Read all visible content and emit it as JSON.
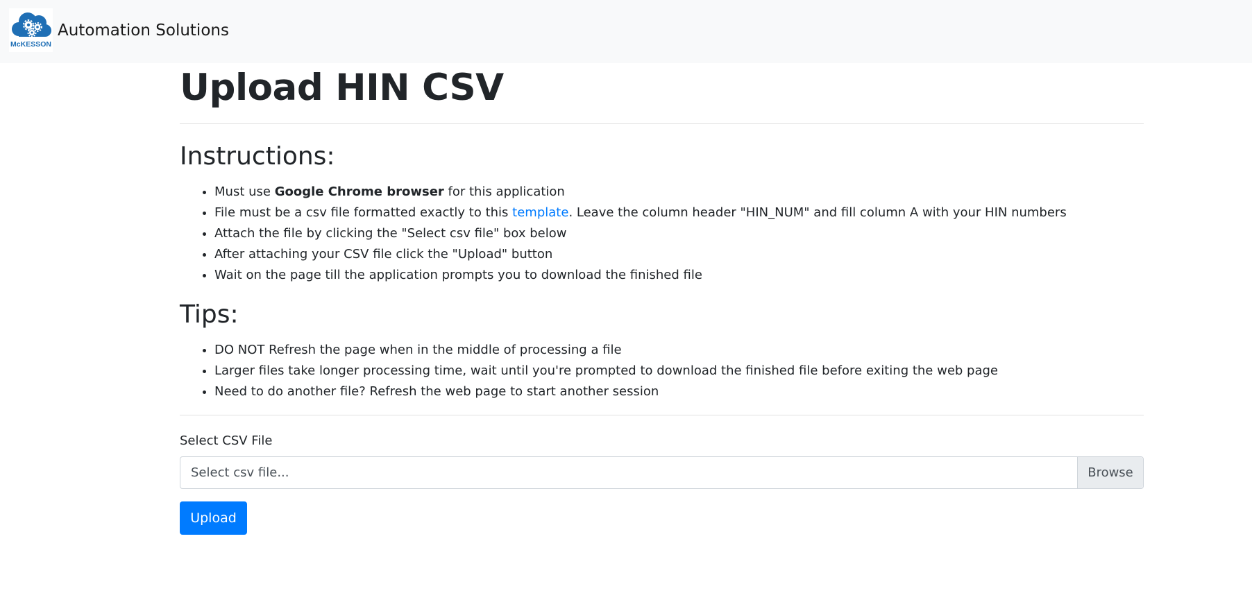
{
  "navbar": {
    "logo_text": "McKESSON",
    "brand_name": "Automation Solutions"
  },
  "main": {
    "title": "Upload HIN CSV",
    "instructions": {
      "heading": "Instructions:",
      "items": [
        {
          "parts": [
            {
              "text": "Must use ",
              "style": "normal"
            },
            {
              "text": "Google Chrome browser",
              "style": "bold"
            },
            {
              "text": " for this application",
              "style": "normal"
            }
          ]
        },
        {
          "parts": [
            {
              "text": "File must be a csv file formatted exactly to this ",
              "style": "normal"
            },
            {
              "text": "template",
              "style": "link"
            },
            {
              "text": ". Leave the column header \"HIN_NUM\" and fill column A with your HIN numbers",
              "style": "normal"
            }
          ]
        },
        {
          "parts": [
            {
              "text": "Attach the file by clicking the \"Select csv file\" box below",
              "style": "normal"
            }
          ]
        },
        {
          "parts": [
            {
              "text": "After attaching your CSV file click the \"Upload\" button",
              "style": "normal"
            }
          ]
        },
        {
          "parts": [
            {
              "text": "Wait on the page till the application prompts you to download the finished file",
              "style": "normal"
            }
          ]
        }
      ]
    },
    "tips": {
      "heading": "Tips:",
      "items": [
        "DO NOT Refresh the page when in the middle of processing a file",
        "Larger files take longer processing time, wait until you're prompted to download the finished file before exiting the web page",
        "Need to do another file? Refresh the web page to start another session"
      ]
    },
    "form": {
      "label": "Select CSV File",
      "file_placeholder": "Select csv file...",
      "browse_label": "Browse",
      "upload_label": "Upload"
    }
  },
  "colors": {
    "navbar_bg": "#f8f9fa",
    "link": "#007bff",
    "button_primary": "#007bff",
    "text": "#212529",
    "logo_blue": "#1f6fb5"
  },
  "icons": {
    "logo": "cloud-gears-icon"
  }
}
